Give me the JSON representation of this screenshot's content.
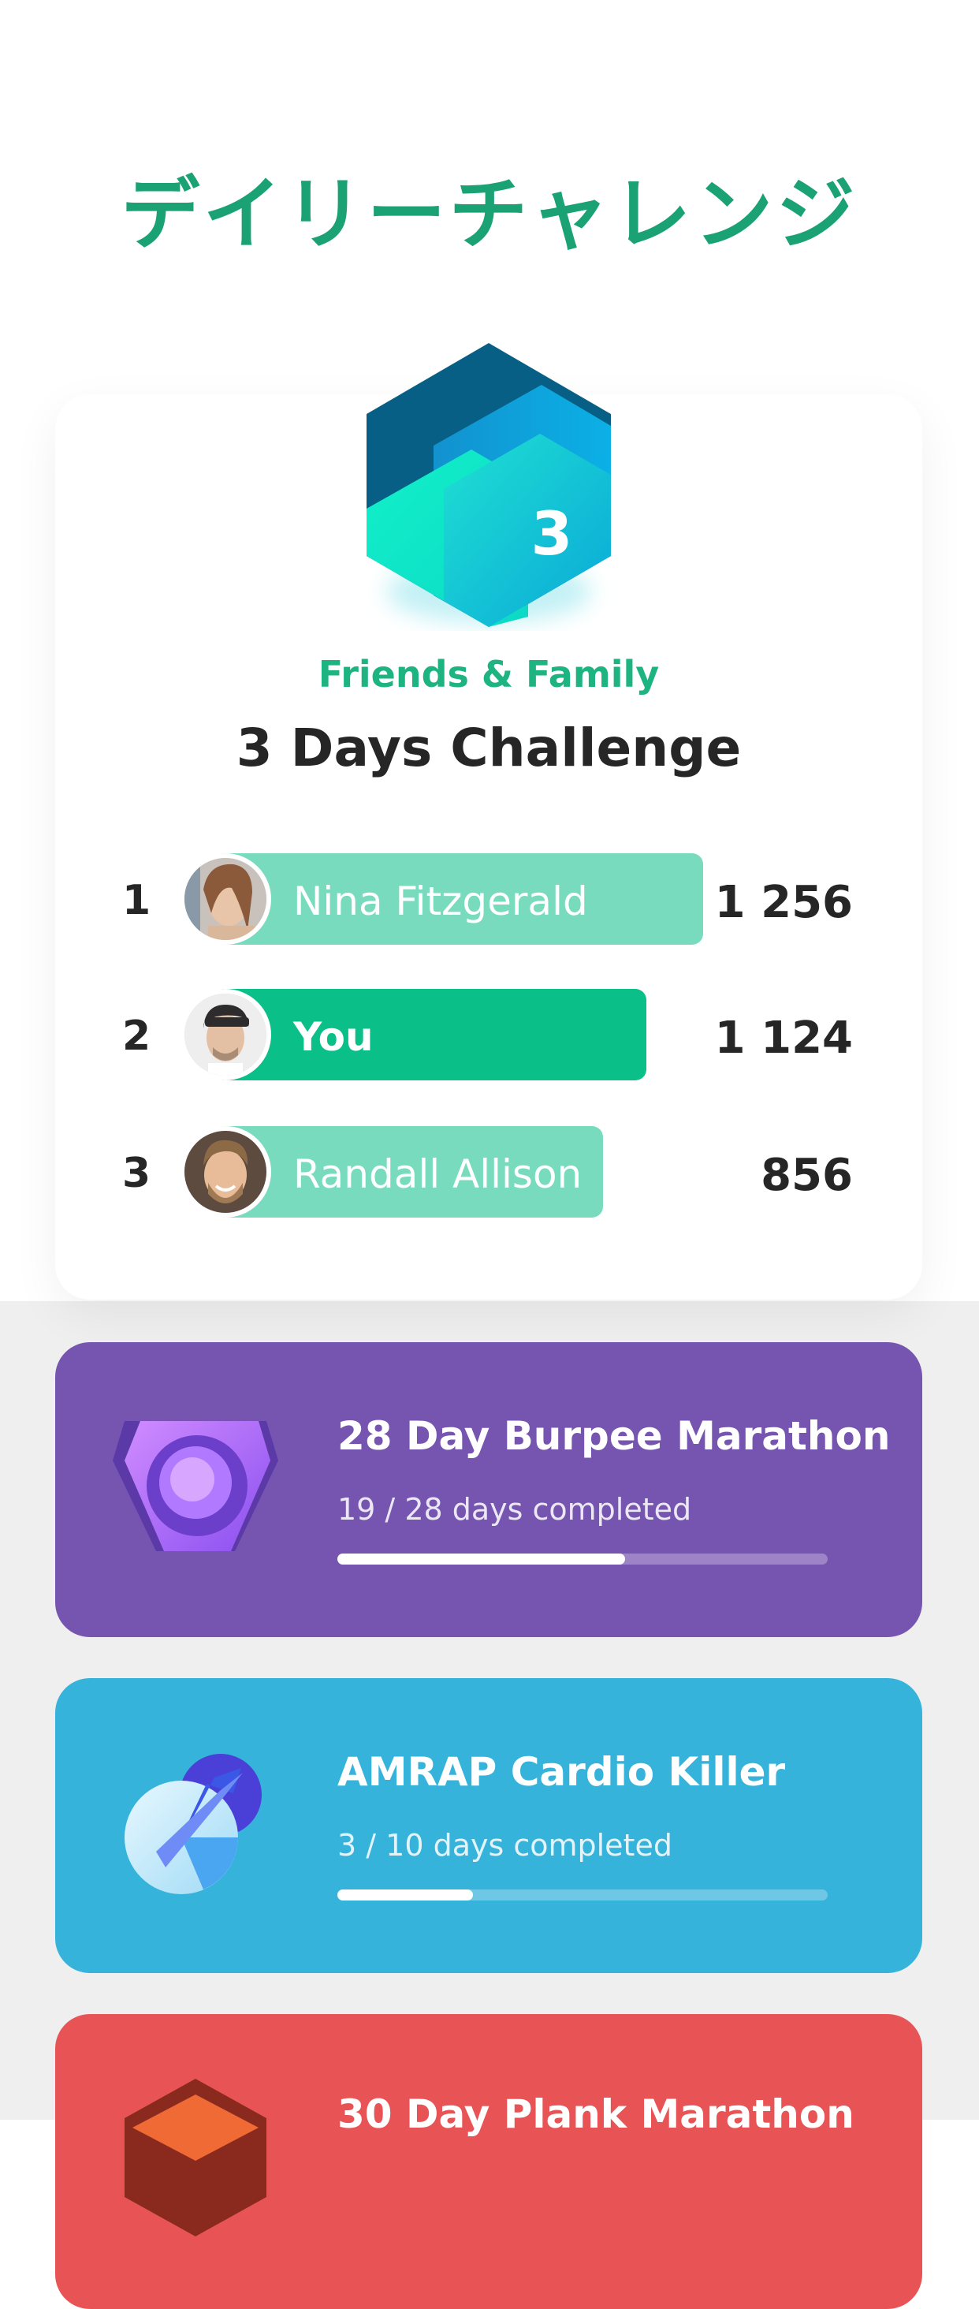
{
  "page": {
    "title": "デイリーチャレンジ"
  },
  "featured": {
    "badge_number": "3",
    "category": "Friends & Family",
    "title": "3 Days Challenge",
    "leaderboard": [
      {
        "rank": "1",
        "name": "Nina Fitzgerald",
        "score": "1 256",
        "bar_fraction": 1.0,
        "color": "#79dbbd"
      },
      {
        "rank": "2",
        "name": "You",
        "score": "1 124",
        "bar_fraction": 0.89,
        "color": "#0abf88"
      },
      {
        "rank": "3",
        "name": "Randall Allison",
        "score": "856",
        "bar_fraction": 0.68,
        "color": "#79dbbd"
      }
    ]
  },
  "challenges": [
    {
      "title": "28 Day Burpee Marathon",
      "progress_text": "19 / 28 days completed",
      "progress": 0.679,
      "color": "#7655b1",
      "icon": "gem-icon"
    },
    {
      "title": "AMRAP Cardio Killer",
      "progress_text": "3 / 10 days completed",
      "progress": 0.3,
      "color": "#36b3db",
      "icon": "arrow-orb-icon"
    },
    {
      "title": "30 Day Plank Marathon",
      "progress_text": "",
      "progress": 0,
      "color": "#e85456",
      "icon": "hex-icon"
    }
  ]
}
